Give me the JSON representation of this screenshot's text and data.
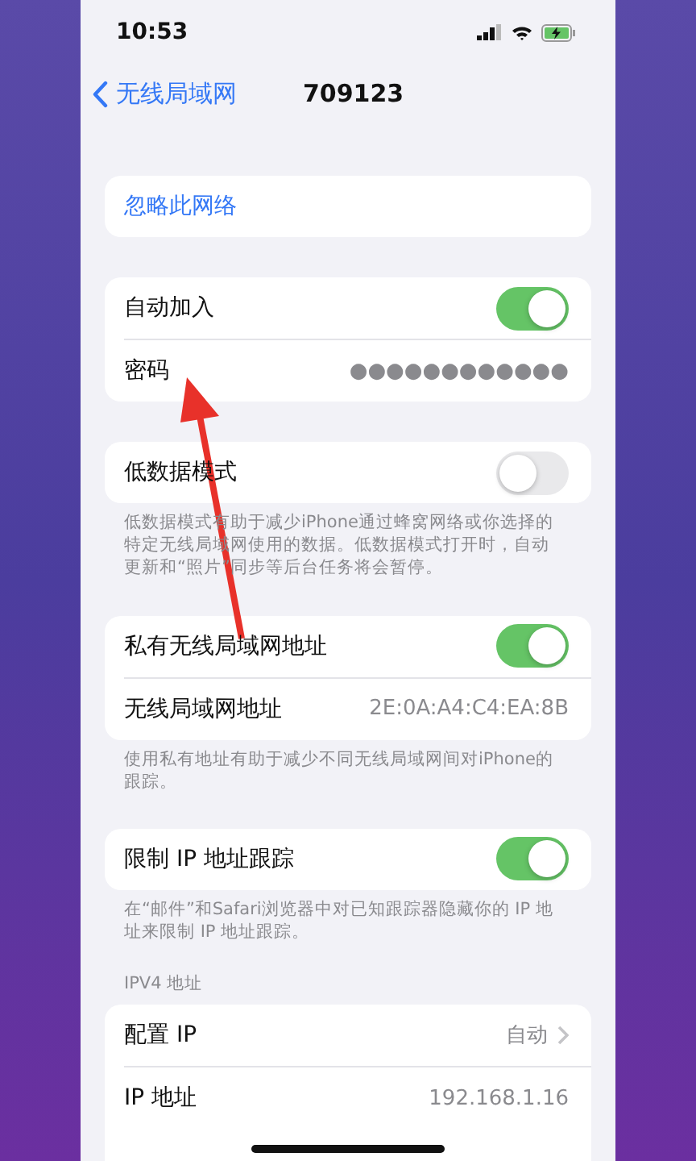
{
  "status_bar": {
    "time": "10:53"
  },
  "nav": {
    "back_label": "无线局域网",
    "title": "709123"
  },
  "groups": [
    {
      "rows": [
        {
          "kind": "link",
          "label": "忽略此网络"
        }
      ]
    },
    {
      "rows": [
        {
          "kind": "toggle",
          "label": "自动加入",
          "on": true
        },
        {
          "kind": "value",
          "label": "密码",
          "value": "●●●●●●●●●●●●"
        }
      ]
    },
    {
      "rows": [
        {
          "kind": "toggle",
          "label": "低数据模式",
          "on": false
        }
      ],
      "footer": "低数据模式有助于减少iPhone通过蜂窝网络或你选择的特定无线局域网使用的数据。低数据模式打开时，自动更新和“照片”同步等后台任务将会暂停。"
    },
    {
      "rows": [
        {
          "kind": "toggle",
          "label": "私有无线局域网地址",
          "on": true
        },
        {
          "kind": "value",
          "label": "无线局域网地址",
          "value": "2E:0A:A4:C4:EA:8B"
        }
      ],
      "footer": "使用私有地址有助于减少不同无线局域网间对iPhone的跟踪。"
    },
    {
      "rows": [
        {
          "kind": "toggle",
          "label": "限制 IP 地址跟踪",
          "on": true
        }
      ],
      "footer": "在“邮件”和Safari浏览器中对已知跟踪器隐藏你的 IP 地址来限制 IP 地址跟踪。"
    },
    {
      "header": "IPV4 地址",
      "rows": [
        {
          "kind": "nav",
          "label": "配置 IP",
          "value": "自动"
        },
        {
          "kind": "value",
          "label": "IP 地址",
          "value": "192.168.1.16"
        }
      ]
    }
  ]
}
